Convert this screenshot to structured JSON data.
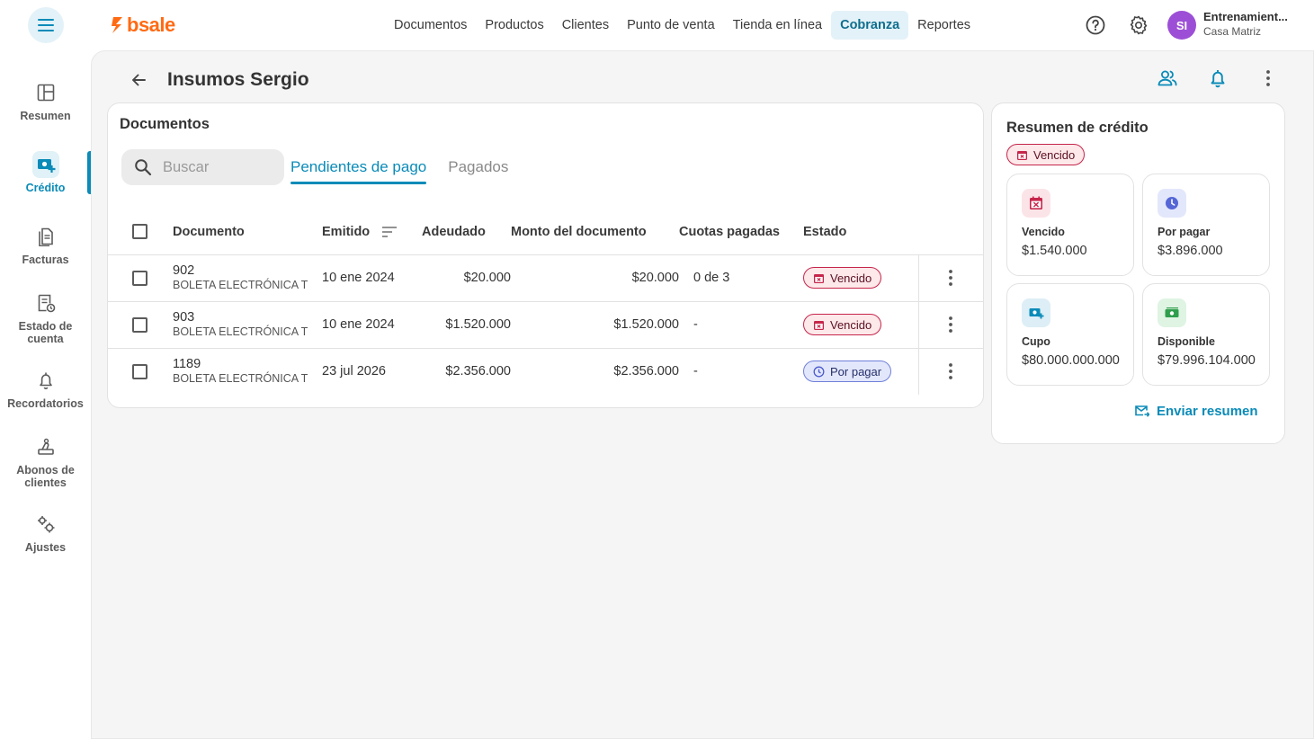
{
  "app": {
    "logo_text": "bsale",
    "brand_color": "#ff6a13",
    "accent_color": "#0a8bb8"
  },
  "nav": {
    "items": [
      {
        "label": "Documentos",
        "active": false
      },
      {
        "label": "Productos",
        "active": false
      },
      {
        "label": "Clientes",
        "active": false
      },
      {
        "label": "Punto de venta",
        "active": false
      },
      {
        "label": "Tienda en línea",
        "active": false
      },
      {
        "label": "Cobranza",
        "active": true
      },
      {
        "label": "Reportes",
        "active": false
      }
    ]
  },
  "account": {
    "initials": "SI",
    "name": "Entrenamient...",
    "branch": "Casa Matriz"
  },
  "sidebar": {
    "items": [
      {
        "label": "Resumen",
        "icon": "dashboard-icon"
      },
      {
        "label": "Crédito",
        "icon": "credit-icon",
        "active": true
      },
      {
        "label": "Facturas",
        "icon": "invoices-icon"
      },
      {
        "label": "Estado de cuenta",
        "icon": "account-statement-icon"
      },
      {
        "label": "Recordatorios",
        "icon": "bell-icon"
      },
      {
        "label": "Abonos de clientes",
        "icon": "payments-icon"
      },
      {
        "label": "Ajustes",
        "icon": "settings-icon"
      }
    ]
  },
  "page": {
    "title": "Insumos Sergio"
  },
  "documents": {
    "title": "Documentos",
    "search_placeholder": "Buscar",
    "tabs": [
      {
        "label": "Pendientes de pago",
        "active": true
      },
      {
        "label": "Pagados",
        "active": false
      }
    ],
    "columns": [
      "Documento",
      "Emitido",
      "Adeudado",
      "Monto del documento",
      "Cuotas pagadas",
      "Estado"
    ],
    "rows": [
      {
        "number": "902",
        "type": "BOLETA ELECTRÓNICA T",
        "issued": "10 ene 2024",
        "owed": "$20.000",
        "amount": "$20.000",
        "installments": "0 de 3",
        "status": "Vencido"
      },
      {
        "number": "903",
        "type": "BOLETA ELECTRÓNICA T",
        "issued": "10 ene 2024",
        "owed": "$1.520.000",
        "amount": "$1.520.000",
        "installments": "-",
        "status": "Vencido"
      },
      {
        "number": "1189",
        "type": "BOLETA ELECTRÓNICA T",
        "issued": "23 jul 2026",
        "owed": "$2.356.000",
        "amount": "$2.356.000",
        "installments": "-",
        "status": "Por pagar"
      }
    ]
  },
  "credit": {
    "title": "Resumen de crédito",
    "status_badge": "Vencido",
    "stats": [
      {
        "label": "Vencido",
        "value": "$1.540.000"
      },
      {
        "label": "Por pagar",
        "value": "$3.896.000"
      },
      {
        "label": "Cupo",
        "value": "$80.000.000.000"
      },
      {
        "label": "Disponible",
        "value": "$79.996.104.000"
      }
    ],
    "send_summary": "Enviar resumen"
  }
}
